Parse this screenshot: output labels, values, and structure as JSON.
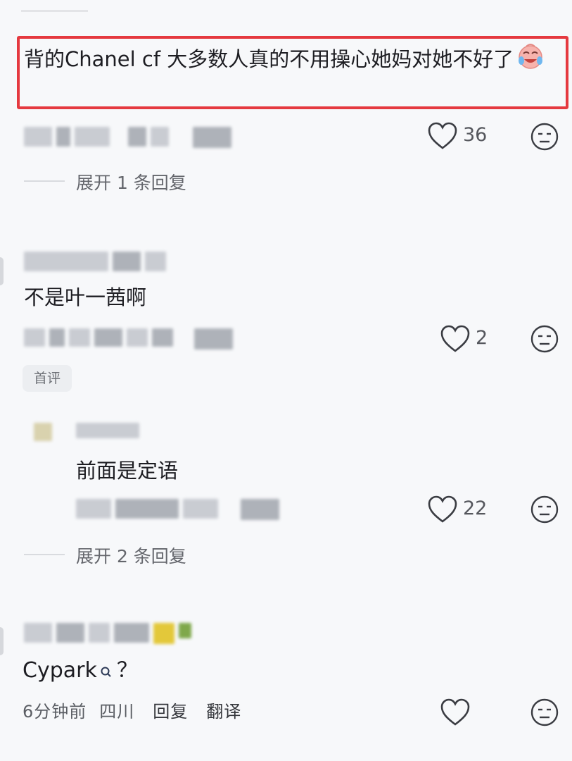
{
  "comments": [
    {
      "text": "背的Chanel cf 大多数人真的不用操心她妈对她不好了",
      "likes": "36",
      "expand_label": "展开 1 条回复"
    },
    {
      "text": "不是叶一茜啊",
      "likes": "2",
      "badge": "首评",
      "reply": {
        "text": "前面是定语",
        "likes": "22",
        "expand_label": "展开 2 条回复"
      }
    },
    {
      "text": "Cypark",
      "text_suffix": "？",
      "time": "6分钟前",
      "location": "四川",
      "reply_label": "回复",
      "translate_label": "翻译"
    }
  ],
  "colors": {
    "highlight_border": "#e5393f",
    "background": "#f7f8fa",
    "icon": "#3a3c42"
  }
}
